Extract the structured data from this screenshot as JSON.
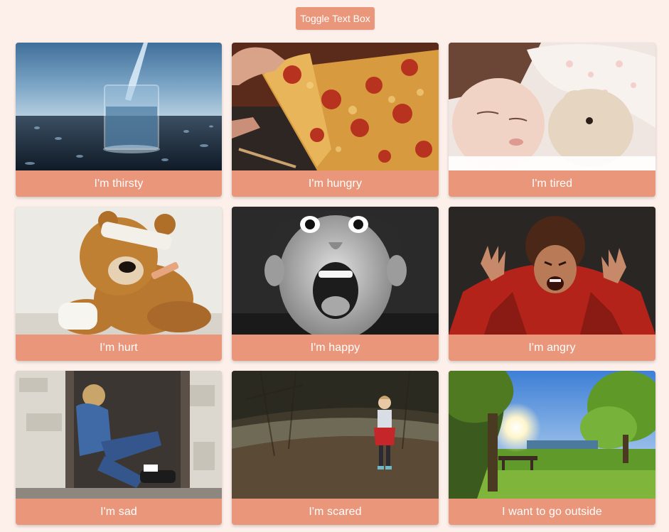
{
  "toolbar": {
    "toggle_label": "Toggle Text Box"
  },
  "colors": {
    "background": "#fdf0eb",
    "accent": "#e9967a",
    "label_text": "#ffffff"
  },
  "cards": [
    {
      "label": "I'm thirsty",
      "photo": "glass-of-water-photo"
    },
    {
      "label": "I'm hungry",
      "photo": "pizza-slice-photo"
    },
    {
      "label": "I'm tired",
      "photo": "sleeping-child-photo"
    },
    {
      "label": "I'm hurt",
      "photo": "bandaged-teddy-bear-photo"
    },
    {
      "label": "I'm happy",
      "photo": "excited-boy-photo"
    },
    {
      "label": "I'm angry",
      "photo": "angry-child-photo"
    },
    {
      "label": "I'm sad",
      "photo": "sad-girl-doorway-photo"
    },
    {
      "label": "I'm scared",
      "photo": "child-in-forest-photo"
    },
    {
      "label": "I want to go outside",
      "photo": "sunny-park-photo"
    }
  ]
}
